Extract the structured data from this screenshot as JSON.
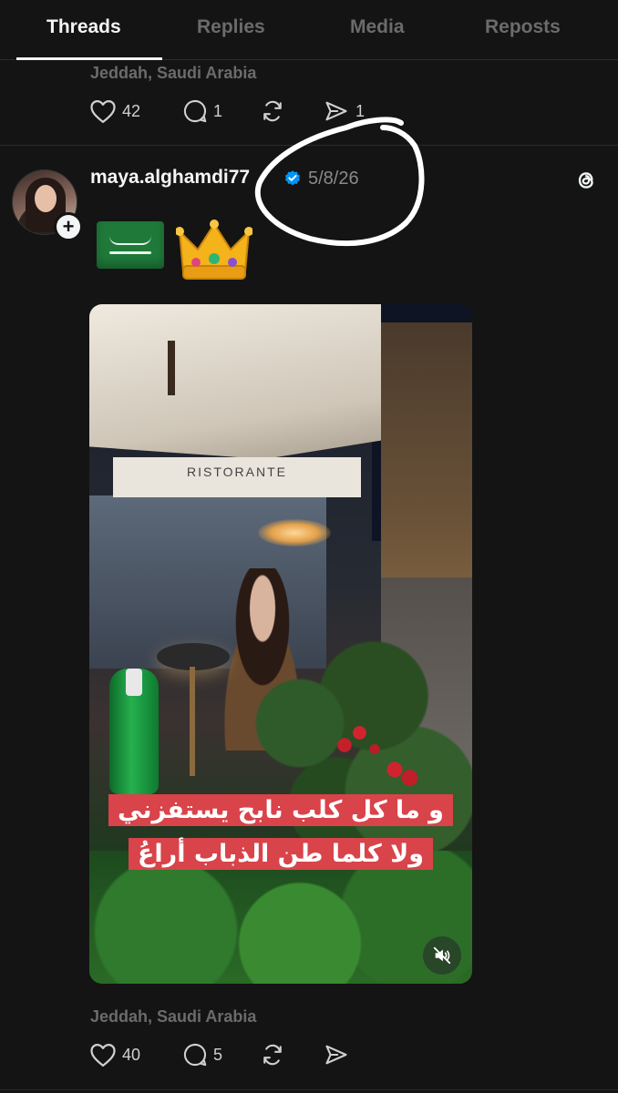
{
  "tabs": [
    {
      "label": "Threads",
      "active": true
    },
    {
      "label": "Replies",
      "active": false
    },
    {
      "label": "Media",
      "active": false
    },
    {
      "label": "Reposts",
      "active": false
    }
  ],
  "previous_post": {
    "location": "Jeddah, Saudi Arabia",
    "likes": "42",
    "replies": "1",
    "shares": "1"
  },
  "post": {
    "username": "maya.alghamdi77",
    "verified": true,
    "date": "5/8/26",
    "emojis": [
      "saudi-flag",
      "crown"
    ],
    "media": {
      "caption_line_1": "و ما كل كلب نابح يستفزني",
      "caption_line_2": "ولا كلما طن الذباب أراعُ",
      "sign_text": "RISTORANTE"
    },
    "location": "Jeddah, Saudi Arabia",
    "likes": "40",
    "replies": "5"
  },
  "colors": {
    "background": "#141414",
    "text": "#f3f5f7",
    "muted": "#6b6b6b",
    "verified": "#0095f6",
    "caption_bg": "#d9434a",
    "annotation": "#ffffff"
  }
}
